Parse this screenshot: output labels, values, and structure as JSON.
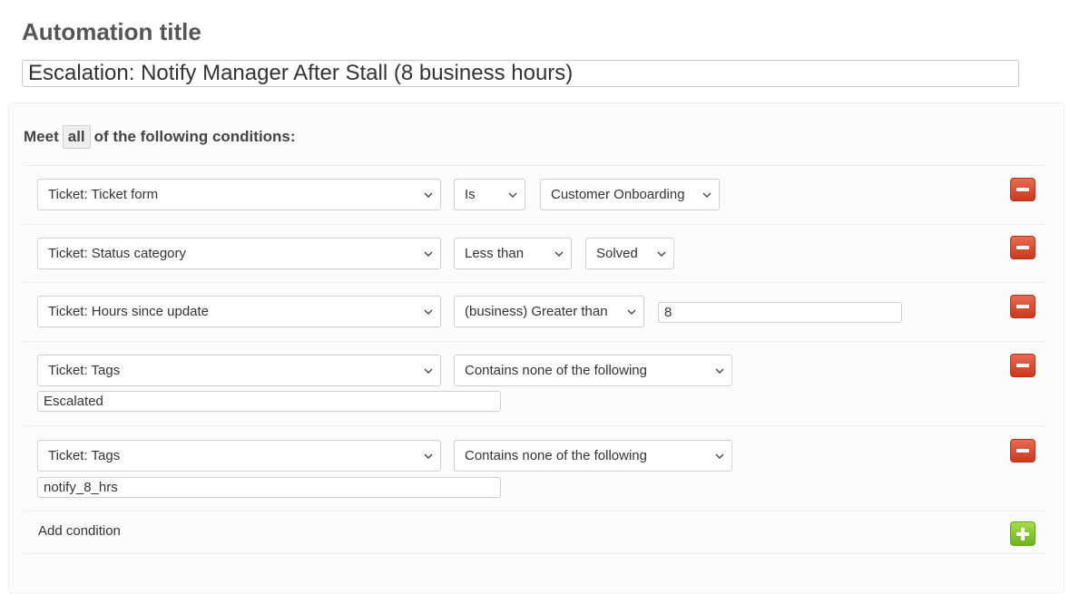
{
  "title_section": {
    "label": "Automation title",
    "value": "Escalation: Notify Manager After Stall (8 business hours)"
  },
  "conditions_header": {
    "prefix": "Meet",
    "match_mode": "all",
    "suffix": "of the following conditions:"
  },
  "conditions": [
    {
      "field": "Ticket: Ticket form",
      "operator": "Is",
      "value": "Customer Onboarding"
    },
    {
      "field": "Ticket: Status category",
      "operator": "Less than",
      "value": "Solved"
    },
    {
      "field": "Ticket: Hours since update",
      "operator": "(business) Greater than",
      "value": "8"
    },
    {
      "field": "Ticket: Tags",
      "operator": "Contains none of the following",
      "value": "Escalated"
    },
    {
      "field": "Ticket: Tags",
      "operator": "Contains none of the following",
      "value": "notify_8_hrs"
    }
  ],
  "add_condition": {
    "label": "Add condition"
  },
  "colors": {
    "remove": "#d9442a",
    "add": "#8cc63f"
  },
  "icons": {
    "remove": "minus-icon",
    "add": "plus-icon",
    "dropdown": "chevron-down-icon"
  }
}
